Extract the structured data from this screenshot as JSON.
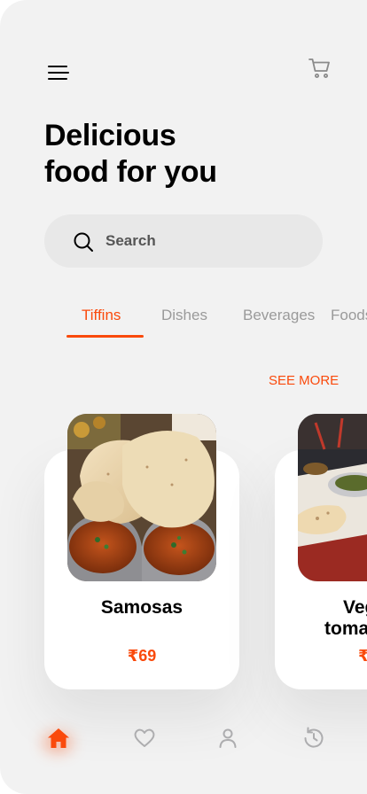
{
  "header": {
    "menu_icon": "hamburger-menu-icon",
    "cart_icon": "shopping-cart-icon",
    "headline_line1": "Delicious",
    "headline_line2": "food for you"
  },
  "search": {
    "placeholder": "Search",
    "icon": "search-icon"
  },
  "tabs": [
    {
      "label": "Tiffins",
      "active": true
    },
    {
      "label": "Dishes",
      "active": false
    },
    {
      "label": "Beverages",
      "active": false
    },
    {
      "label": "Foods",
      "active": false
    }
  ],
  "see_more": "SEE MORE",
  "products": [
    {
      "name": "Samosas",
      "price": "₹69"
    },
    {
      "name_line1": "Veg",
      "name_line2": "toma",
      "price": "₹"
    }
  ],
  "bottom_nav": [
    {
      "icon": "home-icon",
      "active": true
    },
    {
      "icon": "heart-icon",
      "active": false
    },
    {
      "icon": "user-icon",
      "active": false
    },
    {
      "icon": "history-icon",
      "active": false
    }
  ],
  "colors": {
    "accent": "#fa4a0c",
    "background": "#f2f2f2",
    "card": "#ffffff",
    "inactive": "#9a9a9a"
  }
}
